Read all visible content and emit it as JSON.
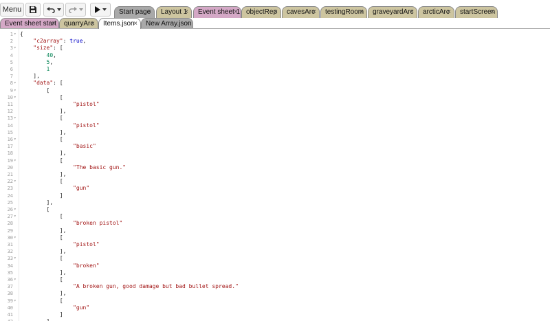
{
  "toolbar": {
    "menu_label": "Menu",
    "icons": [
      "save-icon",
      "undo-icon",
      "redo-icon",
      "play-icon"
    ]
  },
  "tabs_row1": [
    {
      "label": "Start page",
      "color": "#a9a9a9"
    },
    {
      "label": "Layout 1",
      "color": "#cdc5a0"
    },
    {
      "label": "Event sheet 1",
      "color": "#d4a8c6"
    },
    {
      "label": "objectRep",
      "color": "#cdc5a0"
    },
    {
      "label": "cavesArc",
      "color": "#cdc5a0"
    },
    {
      "label": "testingRoom",
      "color": "#cdc5a0"
    },
    {
      "label": "graveyardArc",
      "color": "#cdc5a0"
    },
    {
      "label": "arcticArc",
      "color": "#cdc5a0"
    },
    {
      "label": "startScreen",
      "color": "#cdc5a0"
    }
  ],
  "tabs_row2": [
    {
      "label": "Event sheet start",
      "color": "#d4a8c6"
    },
    {
      "label": "quarryArc",
      "color": "#cdc5a0"
    },
    {
      "label": "Items.json",
      "color": "#ffffff",
      "active": true
    },
    {
      "label": "New Array.json",
      "color": "#a9a9a9"
    }
  ],
  "close_glyph": "×",
  "editor": {
    "lines": [
      {
        "n": "1",
        "fold": true,
        "text": "{"
      },
      {
        "n": "2",
        "fold": false,
        "text": "    \"c2array\": true,"
      },
      {
        "n": "3",
        "fold": true,
        "text": "    \"size\": ["
      },
      {
        "n": "4",
        "fold": false,
        "text": "        40,"
      },
      {
        "n": "5",
        "fold": false,
        "text": "        5,"
      },
      {
        "n": "6",
        "fold": false,
        "text": "        1"
      },
      {
        "n": "7",
        "fold": false,
        "text": "    ],"
      },
      {
        "n": "8",
        "fold": true,
        "text": "    \"data\": ["
      },
      {
        "n": "9",
        "fold": true,
        "text": "        ["
      },
      {
        "n": "10",
        "fold": true,
        "text": "            ["
      },
      {
        "n": "11",
        "fold": false,
        "text": "                \"pistol\""
      },
      {
        "n": "12",
        "fold": false,
        "text": "            ],"
      },
      {
        "n": "13",
        "fold": true,
        "text": "            ["
      },
      {
        "n": "14",
        "fold": false,
        "text": "                \"pistol\""
      },
      {
        "n": "15",
        "fold": false,
        "text": "            ],"
      },
      {
        "n": "16",
        "fold": true,
        "text": "            ["
      },
      {
        "n": "17",
        "fold": false,
        "text": "                \"basic\""
      },
      {
        "n": "18",
        "fold": false,
        "text": "            ],"
      },
      {
        "n": "19",
        "fold": true,
        "text": "            ["
      },
      {
        "n": "20",
        "fold": false,
        "text": "                \"The basic gun.\""
      },
      {
        "n": "21",
        "fold": false,
        "text": "            ],"
      },
      {
        "n": "22",
        "fold": true,
        "text": "            ["
      },
      {
        "n": "23",
        "fold": false,
        "text": "                \"gun\""
      },
      {
        "n": "24",
        "fold": false,
        "text": "            ]"
      },
      {
        "n": "25",
        "fold": false,
        "text": "        ],"
      },
      {
        "n": "26",
        "fold": true,
        "text": "        ["
      },
      {
        "n": "27",
        "fold": true,
        "text": "            ["
      },
      {
        "n": "28",
        "fold": false,
        "text": "                \"broken pistol\""
      },
      {
        "n": "29",
        "fold": false,
        "text": "            ],"
      },
      {
        "n": "30",
        "fold": true,
        "text": "            ["
      },
      {
        "n": "31",
        "fold": false,
        "text": "                \"pistol\""
      },
      {
        "n": "32",
        "fold": false,
        "text": "            ],"
      },
      {
        "n": "33",
        "fold": true,
        "text": "            ["
      },
      {
        "n": "34",
        "fold": false,
        "text": "                \"broken\""
      },
      {
        "n": "35",
        "fold": false,
        "text": "            ],"
      },
      {
        "n": "36",
        "fold": true,
        "text": "            ["
      },
      {
        "n": "37",
        "fold": false,
        "text": "                \"A broken gun, good damage but bad bullet spread.\""
      },
      {
        "n": "38",
        "fold": false,
        "text": "            ],"
      },
      {
        "n": "39",
        "fold": true,
        "text": "            ["
      },
      {
        "n": "40",
        "fold": false,
        "text": "                \"gun\""
      },
      {
        "n": "41",
        "fold": false,
        "text": "            ]"
      },
      {
        "n": "42",
        "fold": false,
        "text": "        ],"
      }
    ]
  }
}
